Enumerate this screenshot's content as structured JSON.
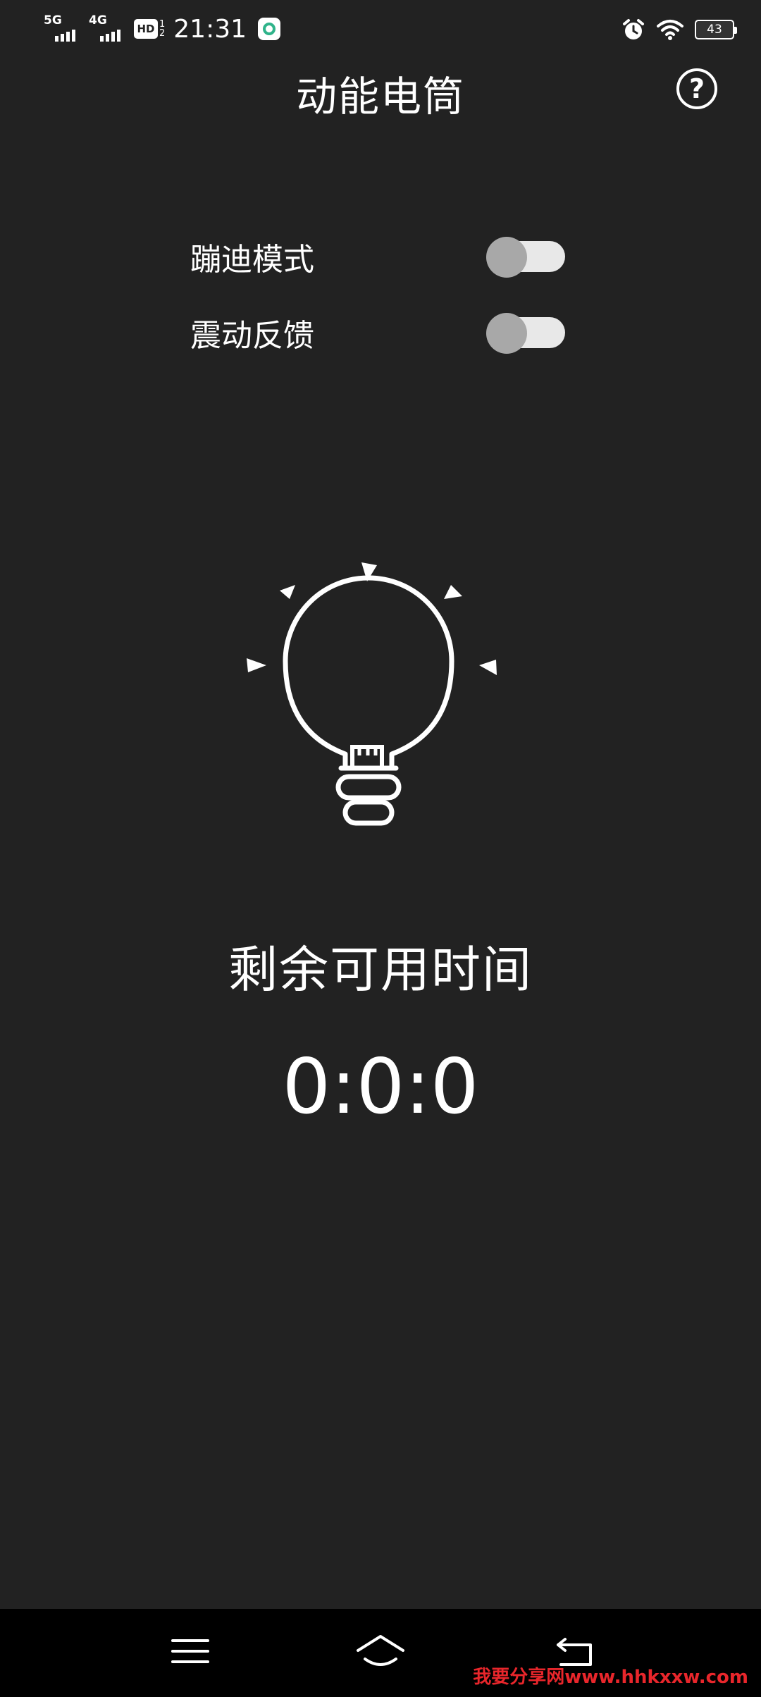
{
  "status_bar": {
    "net1": "5G",
    "net2": "4G",
    "hd": "HD",
    "hd_sub1": "1",
    "hd_sub2": "2",
    "time": "21:31",
    "battery": "43"
  },
  "header": {
    "title": "动能电筒",
    "help": "?"
  },
  "settings": [
    {
      "label": "蹦迪模式",
      "enabled": false
    },
    {
      "label": "震动反馈",
      "enabled": false
    }
  ],
  "main": {
    "remaining_label": "剩余可用时间",
    "remaining_value": "0:0:0"
  },
  "watermark": "我要分享网www.hhkxxw.com",
  "icons": {
    "help": "question-circle-icon",
    "bulb": "lightbulb-icon",
    "menu": "menu-icon",
    "home": "home-icon",
    "back": "back-icon"
  },
  "colors": {
    "background": "#222222",
    "foreground": "#ffffff",
    "switch_track": "#e8e8e8",
    "switch_thumb": "#a8a8a8",
    "watermark": "#e8262b"
  }
}
